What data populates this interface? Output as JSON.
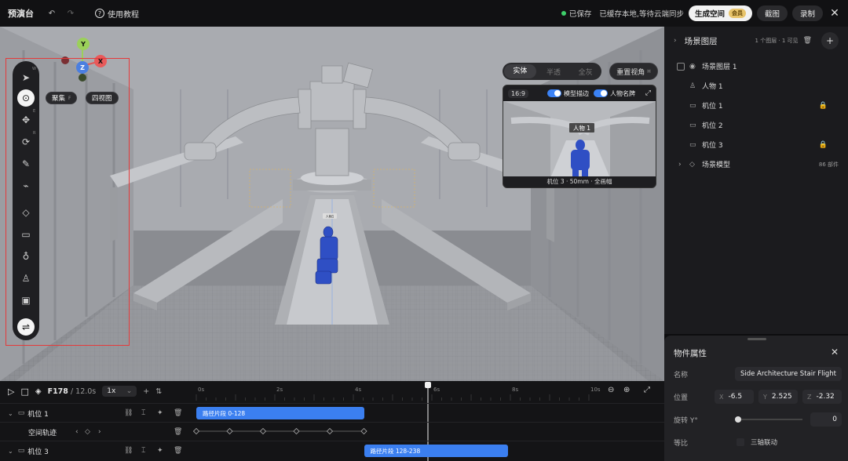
{
  "app": {
    "title": "预演台",
    "help_label": "使用教程"
  },
  "topbar": {
    "saved_label": "已保存",
    "sync_status": "已缓存本地,等待云端同步",
    "generate_label": "生成空间",
    "vip_badge": "会员",
    "screenshot_label": "截图",
    "record_label": "录制"
  },
  "tools": {
    "focus_label": "聚集",
    "focus_key": "F",
    "quad_view_label": "四视图",
    "gizmo": {
      "y": "Y",
      "x": "X",
      "z": "Z"
    },
    "keys": {
      "w": "W",
      "e": "E",
      "r": "R"
    }
  },
  "viewport": {
    "shading_modes": [
      "实体",
      "半透",
      "全灰"
    ],
    "active_shading": "实体",
    "reset_view_label": "重置视角",
    "reset_view_key": "H",
    "character_tag": "人物1"
  },
  "preview": {
    "aspect": "16:9",
    "outline_label": "模型描边",
    "nameplate_label": "人物名牌",
    "character_tag": "人物 1",
    "caption": "机位 3 · 50mm · 全画幅"
  },
  "layers": {
    "title": "场景图层",
    "meta": "1 个图层 · 1 可见",
    "items": [
      {
        "label": "场景图层 1",
        "locked": false
      },
      {
        "label": "人物 1",
        "locked": false
      },
      {
        "label": "机位 1",
        "locked": true
      },
      {
        "label": "机位 2",
        "locked": false
      },
      {
        "label": "机位 3",
        "locked": true
      },
      {
        "label": "场景模型",
        "locked": false,
        "meta": "86 部件"
      }
    ]
  },
  "properties": {
    "title": "物件属性",
    "name_label": "名称",
    "name_value": "Side Architecture Stair Flight",
    "position_label": "位置",
    "position": {
      "x": "-6.5",
      "y": "2.525",
      "z": "-2.32"
    },
    "rotation_label": "旋转 Y°",
    "rotation_value": "0",
    "rotation_fraction": 0.02,
    "scale_label": "等比",
    "tri_axis_label": "三轴联动"
  },
  "timeline": {
    "frame": "F178",
    "duration": "/ 12.0s",
    "speed": "1x",
    "ticks": [
      "0s",
      "2s",
      "4s",
      "6s",
      "8s",
      "10s"
    ],
    "playhead_seconds": 5.9,
    "tracks": [
      {
        "label": "机位 1",
        "clip": "路径片段 0-128",
        "clip_start": 0,
        "clip_end": 4.27
      },
      {
        "label": "空间轨迹",
        "keyframes": [
          0,
          0.85,
          1.7,
          2.55,
          3.4,
          4.27
        ]
      },
      {
        "label": "机位 3",
        "clip": "路径片段 128-238",
        "clip_start": 4.27,
        "clip_end": 7.93
      }
    ]
  },
  "colors": {
    "accent": "#3b7ff0",
    "lock": "#e69a2e",
    "saved": "#3ecf6a",
    "highlight_box": "#e53a3a"
  }
}
